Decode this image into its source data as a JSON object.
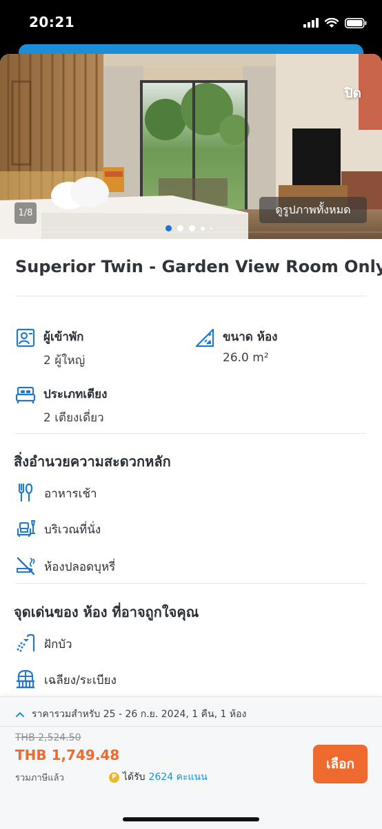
{
  "status_bar": {
    "time": "20:21"
  },
  "gallery": {
    "close_label": "ปิด",
    "counter": "1/8",
    "view_all_label": "ดูรูปภาพทั้งหมด",
    "current_index": 1,
    "total": 8
  },
  "room": {
    "title": "Superior Twin - Garden View Room Only"
  },
  "features": {
    "guests": {
      "label": "ผู้เข้าพัก",
      "value": "2 ผู้ใหญ่",
      "icon": "guest-icon"
    },
    "size": {
      "label": "ขนาด ห้อง",
      "value": "26.0 m²",
      "icon": "ruler-icon"
    },
    "bed": {
      "label": "ประเภทเตียง",
      "value": "2 เตียงเดี่ยว",
      "icon": "bed-icon"
    }
  },
  "amenities": {
    "title": "สิ่งอำนวยความสะดวกหลัก",
    "items": [
      {
        "label": "อาหารเช้า",
        "icon": "breakfast-icon"
      },
      {
        "label": "บริเวณที่นั่ง",
        "icon": "sofa-icon"
      },
      {
        "label": "ห้องปลอดบุหรี่",
        "icon": "no-smoking-icon"
      }
    ]
  },
  "highlights": {
    "title": "จุดเด่นของ ห้อง ที่อาจถูกใจคุณ",
    "items": [
      {
        "label": "ฝักบัว",
        "icon": "shower-icon"
      },
      {
        "label": "เฉลียง/ระเบียง",
        "icon": "balcony-icon"
      }
    ]
  },
  "booking": {
    "date_summary": "ราคารวมสำหรับ 25 - 26 ก.ย. 2024, 1 คืน, 1 ห้อง",
    "original_price": "THB 2,524.50",
    "price": "THB 1,749.48",
    "tax_note": "รวมภาษีแล้ว",
    "points_prefix": "ได้รับ",
    "points_value": "2624 คะแนน",
    "select_label": "เลือก"
  },
  "colors": {
    "accent_blue": "#1a8fd8",
    "price_orange": "#ef6a2e",
    "icon_blue": "#1f78d1"
  }
}
